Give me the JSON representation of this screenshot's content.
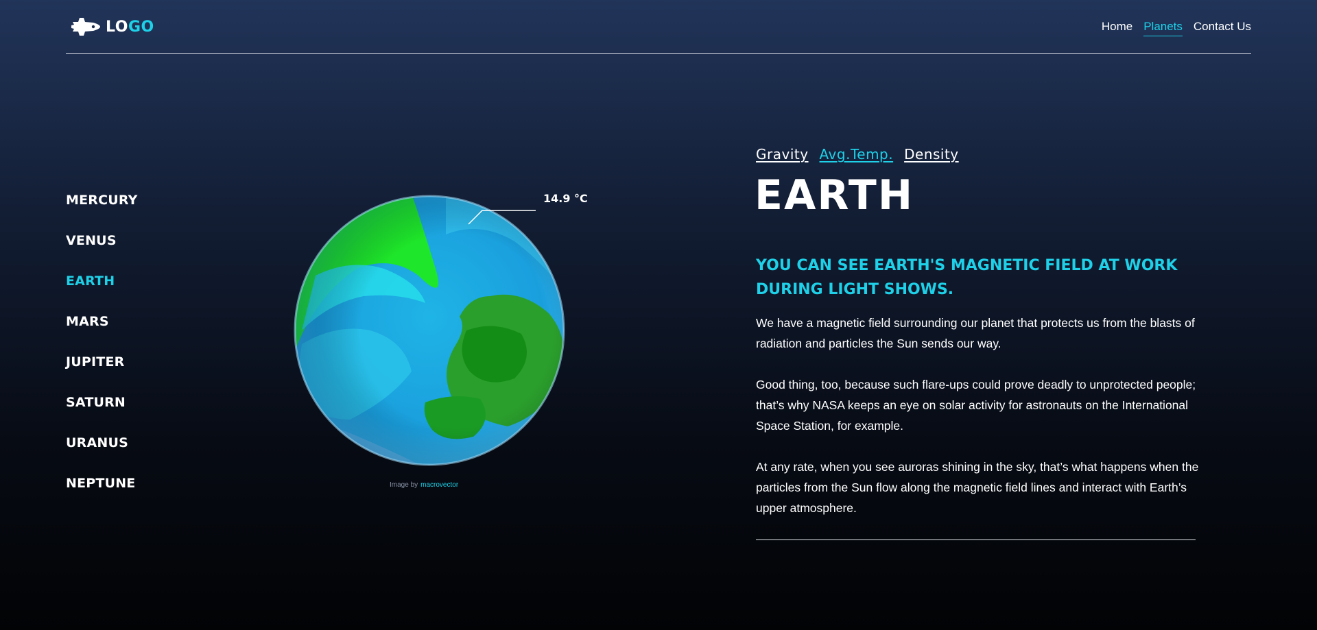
{
  "header": {
    "logo_part1": "LO",
    "logo_part2": "GO",
    "logo_icon": "space-shuttle-icon",
    "nav": [
      {
        "label": "Home",
        "active": false
      },
      {
        "label": "Planets",
        "active": true
      },
      {
        "label": "Contact Us",
        "active": false
      }
    ]
  },
  "sidebar": {
    "planets": [
      {
        "label": "MERCURY",
        "active": false
      },
      {
        "label": "VENUS",
        "active": false
      },
      {
        "label": "EARTH",
        "active": true
      },
      {
        "label": "MARS",
        "active": false
      },
      {
        "label": "JUPITER",
        "active": false
      },
      {
        "label": "SATURN",
        "active": false
      },
      {
        "label": "URANUS",
        "active": false
      },
      {
        "label": "NEPTUNE",
        "active": false
      }
    ]
  },
  "planet_image": {
    "temperature": "14.9 °C",
    "credit_prefix": "Image by",
    "credit_link": "macrovector"
  },
  "details": {
    "tabs": [
      {
        "label": "Gravity",
        "active": false
      },
      {
        "label": "Avg.Temp.",
        "active": true
      },
      {
        "label": "Density",
        "active": false
      }
    ],
    "title": "EARTH",
    "subheading": "YOU CAN SEE EARTH'S MAGNETIC FIELD AT WORK DURING LIGHT SHOWS.",
    "paragraphs": [
      "We have a magnetic field surrounding our planet that protects us from the blasts of radiation and particles the Sun sends our way.",
      "Good thing, too, because such flare-ups could prove deadly to unprotected people; that’s why NASA keeps an eye on solar activity for astronauts on the International Space Station, for example.",
      "At any rate, when you see auroras shining in the sky, that’s what happens when the particles from the Sun flow along the magnetic field lines and interact with Earth’s upper atmosphere."
    ]
  },
  "colors": {
    "accent": "#1ed1e8",
    "text": "#ffffff",
    "background_top": "#213459",
    "background_bottom": "#020305"
  }
}
